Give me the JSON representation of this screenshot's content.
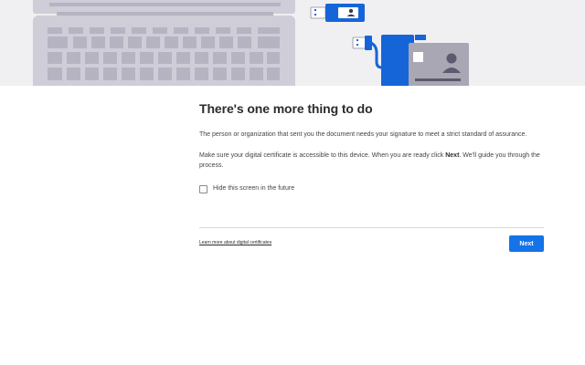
{
  "dialog": {
    "title": "There's one more thing to do",
    "paragraph1": "The person or organization that sent you the document needs your signature to meet a strict standard of assurance.",
    "paragraph2_before": "Make sure your digital certificate is accessible to this device. When you are ready click ",
    "paragraph2_bold": "Next",
    "paragraph2_after": ". We'll guide you through the process.",
    "checkbox_label": "Hide this screen in the future",
    "checkbox_checked": false,
    "learn_more_link": "Learn more about digital certificates",
    "next_button": "Next"
  },
  "illustration": {
    "icons": [
      "laptop-icon",
      "usb-card-icon",
      "usb-token-icon",
      "id-card-icon"
    ]
  },
  "colors": {
    "accent": "#1473e6",
    "hero_background": "#f0f0f2",
    "laptop": "#cfcdd8",
    "laptop_keys": "#b6b4c2",
    "usb_blue": "#1665d8",
    "id_card": "#a9a7b4"
  }
}
